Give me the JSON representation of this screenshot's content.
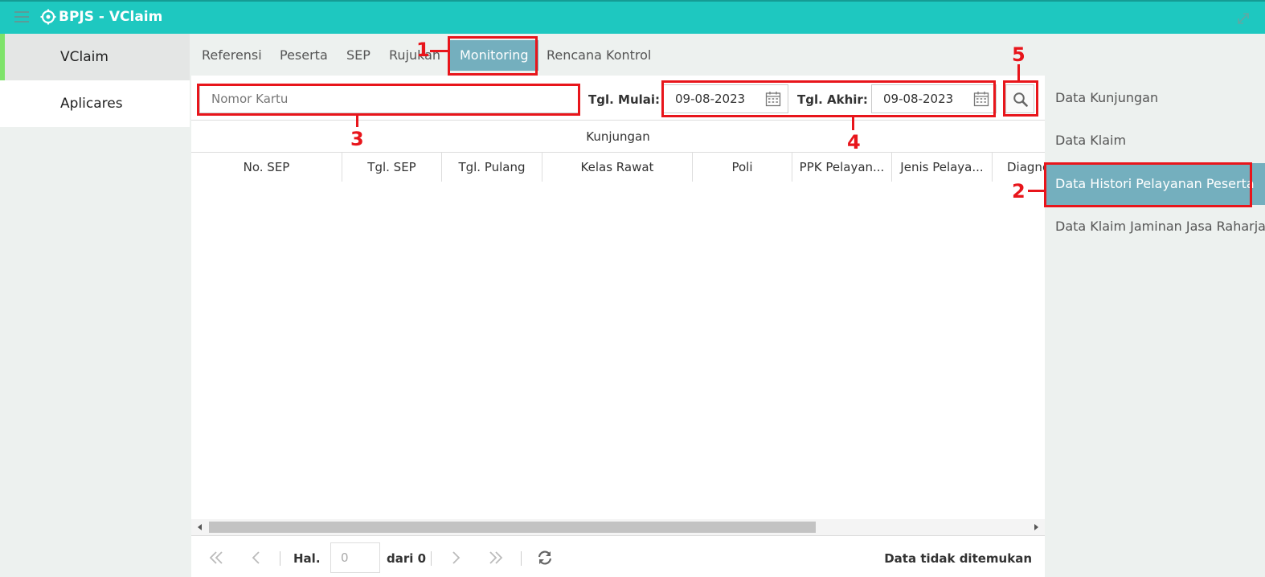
{
  "app": {
    "title": "BPJS - VClaim"
  },
  "left_nav": {
    "items": [
      "VClaim",
      "Aplicares"
    ]
  },
  "tabs": [
    "Referensi",
    "Peserta",
    "SEP",
    "Rujukan",
    "Monitoring",
    "Rencana Kontrol"
  ],
  "filter": {
    "card_placeholder": "Nomor Kartu",
    "start_label": "Tgl. Mulai:",
    "start_value": "09-08-2023",
    "end_label": "Tgl. Akhir:",
    "end_value": "09-08-2023"
  },
  "grid": {
    "title": "Kunjungan",
    "columns": [
      "No. SEP",
      "Tgl. SEP",
      "Tgl. Pulang",
      "Kelas Rawat",
      "Poli",
      "PPK Pelayan...",
      "Jenis Pelaya...",
      "Diagnosa"
    ]
  },
  "pager": {
    "page_label": "Hal.",
    "page_value": "0",
    "of_label": "dari 0",
    "status": "Data tidak ditemukan"
  },
  "right_nav": {
    "items": [
      "Data Kunjungan",
      "Data Klaim",
      "Data Histori Pelayanan Peserta",
      "Data Klaim Jaminan Jasa Raharja"
    ]
  },
  "annotations": [
    "1",
    "2",
    "3",
    "4",
    "5"
  ],
  "colors": {
    "topbar": "#1ec8c0",
    "active": "#74afbe",
    "annotation": "#e8151b",
    "nav_accent": "#7ee36a"
  }
}
